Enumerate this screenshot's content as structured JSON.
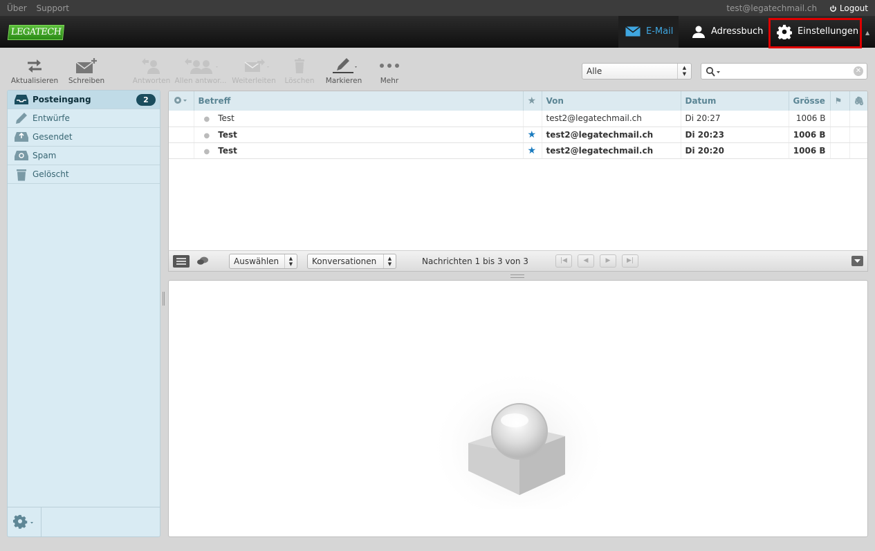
{
  "topline": {
    "links": [
      "Über",
      "Support"
    ],
    "user": "test@legatechmail.ch",
    "logout": "Logout"
  },
  "header": {
    "logo": "LEGATECH",
    "tasks": {
      "mail": "E-Mail",
      "addressbook": "Adressbuch",
      "settings": "Einstellungen"
    }
  },
  "toolbar": {
    "refresh": "Aktualisieren",
    "compose": "Schreiben",
    "reply": "Antworten",
    "reply_all": "Allen antwor...",
    "forward": "Weiterleiten",
    "delete": "Löschen",
    "mark": "Markieren",
    "more": "Mehr"
  },
  "filter": {
    "value": "Alle"
  },
  "folders": {
    "items": [
      {
        "label": "Posteingang",
        "badge": "2"
      },
      {
        "label": "Entwürfe"
      },
      {
        "label": "Gesendet"
      },
      {
        "label": "Spam"
      },
      {
        "label": "Gelöscht"
      }
    ]
  },
  "messagelist": {
    "columns": {
      "subject": "Betreff",
      "from": "Von",
      "date": "Datum",
      "size": "Grösse"
    },
    "rows": [
      {
        "subject": "Test",
        "from": "test2@legatechmail.ch",
        "date": "Di 20:27",
        "size": "1006 B",
        "flagged": false,
        "unread": false
      },
      {
        "subject": "Test",
        "from": "test2@legatechmail.ch",
        "date": "Di 20:23",
        "size": "1006 B",
        "flagged": true,
        "unread": true
      },
      {
        "subject": "Test",
        "from": "test2@legatechmail.ch",
        "date": "Di 20:20",
        "size": "1006 B",
        "flagged": true,
        "unread": true
      }
    ]
  },
  "listfooter": {
    "select": "Auswählen",
    "threads": "Konversationen",
    "count": "Nachrichten 1 bis 3 von 3"
  },
  "colors": {
    "accent": "#3fa6e0",
    "highlight": "#e00000",
    "folderpane": "#d9ebf3"
  }
}
